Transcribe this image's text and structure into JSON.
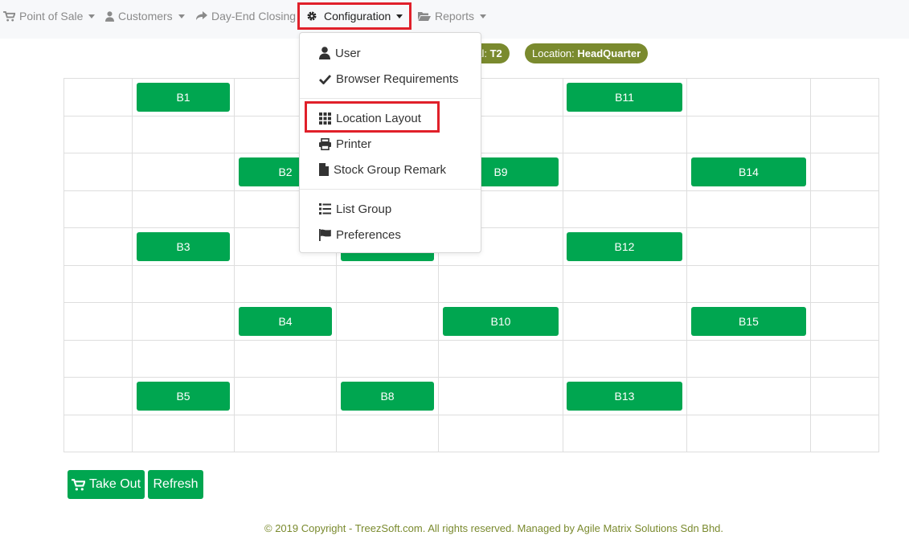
{
  "navbar": {
    "items": [
      {
        "label": "Point of Sale",
        "icon": "cart-icon"
      },
      {
        "label": "Customers",
        "icon": "user-icon"
      },
      {
        "label": "Day-End Closing",
        "icon": "share-icon"
      },
      {
        "label": "Configuration",
        "icon": "gear-icon"
      },
      {
        "label": "Reports",
        "icon": "folder-open-icon"
      }
    ]
  },
  "status": {
    "terminal_label": "nal:",
    "terminal_value": "T2",
    "location_label": "Location:",
    "location_value": "HeadQuarter"
  },
  "config_menu": {
    "items": [
      {
        "label": "User",
        "icon": "user-icon"
      },
      {
        "label": "Browser Requirements",
        "icon": "check-icon"
      },
      {
        "label": "Location Layout",
        "icon": "grid-icon"
      },
      {
        "label": "Printer",
        "icon": "printer-icon"
      },
      {
        "label": "Stock Group Remark",
        "icon": "file-icon"
      },
      {
        "label": "List Group",
        "icon": "list-icon"
      },
      {
        "label": "Preferences",
        "icon": "flag-icon"
      }
    ]
  },
  "tables": {
    "b1": "B1",
    "b2": "B2",
    "b3": "B3",
    "b4": "B4",
    "b5": "B5",
    "b6": "",
    "b8": "B8",
    "b9": "B9",
    "b10": "B10",
    "b11": "B11",
    "b12": "B12",
    "b13": "B13",
    "b14": "B14",
    "b15": "B15"
  },
  "actions": {
    "take_out": "Take Out",
    "refresh": "Refresh"
  },
  "footer": {
    "text": "© 2019 Copyright - TreezSoft.com. All rights reserved. Managed by Agile Matrix Solutions Sdn Bhd."
  },
  "colors": {
    "accent_green": "#00a650",
    "badge_olive": "#7a8a2e",
    "highlight_red": "#e0202a"
  }
}
